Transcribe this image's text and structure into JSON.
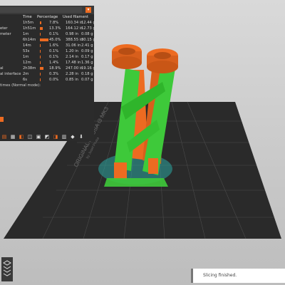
{
  "stats_table": {
    "headers": {
      "time": "Time",
      "percentage": "Percentage",
      "used_filament": "Used filament"
    },
    "rows": [
      {
        "name": "",
        "time": "1h5m",
        "pct": "7.8%",
        "pct_value": 7.8,
        "m": "160.34 in",
        "g": "12.44 g"
      },
      {
        "name": "eter",
        "time": "1h51m",
        "pct": "13.3%",
        "pct_value": 13.3,
        "m": "164.12 in",
        "g": "12.73 g"
      },
      {
        "name": "meter",
        "time": "1m",
        "pct": "0.1%",
        "pct_value": 0.1,
        "m": "0.98 in",
        "g": "0.08 g"
      },
      {
        "name": "",
        "time": "6h14m",
        "pct": "45.0%",
        "pct_value": 45.0,
        "m": "388.55 in",
        "g": "30.15 g"
      },
      {
        "name": "",
        "time": "14m",
        "pct": "1.6%",
        "pct_value": 1.6,
        "m": "31.06 in",
        "g": "2.41 g"
      },
      {
        "name": "",
        "time": "53s",
        "pct": "0.1%",
        "pct_value": 0.1,
        "m": "1.20 in",
        "g": "0.09 g"
      },
      {
        "name": "",
        "time": "1m",
        "pct": "0.1%",
        "pct_value": 0.1,
        "m": "2.14 in",
        "g": "0.17 g"
      },
      {
        "name": "",
        "time": "12m",
        "pct": "1.4%",
        "pct_value": 1.4,
        "m": "17.48 in",
        "g": "1.36 g"
      },
      {
        "name": "al",
        "time": "2h38m",
        "pct": "18.9%",
        "pct_value": 18.9,
        "m": "247.00 in",
        "g": "19.16 g"
      },
      {
        "name": "al interface",
        "time": "2m",
        "pct": "0.3%",
        "pct_value": 0.3,
        "m": "2.28 in",
        "g": "0.18 g"
      },
      {
        "name": "",
        "time": "6s",
        "pct": "0.0%",
        "pct_value": 0.0,
        "m": "0.85 in",
        "g": "0.07 g"
      }
    ],
    "footer_note": "times (Normal mode):"
  },
  "bed_label": {
    "line1": "ORIGINAL PRUSA i3 MK3",
    "line2": "by Josef Prusa"
  },
  "toast": {
    "message": "Slicing finished."
  },
  "colors": {
    "accent": "#ed6b21",
    "support": "#3ec93a",
    "panel_bg": "#2b2b2b",
    "bed": "#2a2a2a",
    "bed_grid": "#4a4a4a"
  },
  "icons": [
    "view-icons",
    "toolbar-icons"
  ]
}
